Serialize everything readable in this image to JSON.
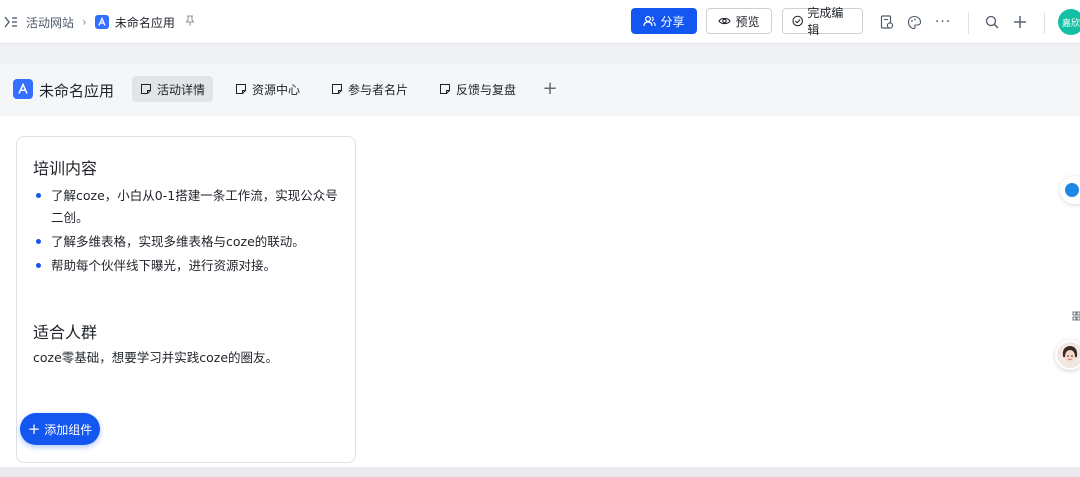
{
  "breadcrumb": {
    "site": "活动网站",
    "separator": "›",
    "current": "未命名应用"
  },
  "toolbar": {
    "share_label": "分享",
    "preview_label": "预览",
    "finish_label": "完成编辑",
    "more_label": "···",
    "avatar_text": "嘉欣"
  },
  "app": {
    "name": "未命名应用",
    "tabs": [
      {
        "label": "活动详情",
        "active": true
      },
      {
        "label": "资源中心",
        "active": false
      },
      {
        "label": "参与者名片",
        "active": false
      },
      {
        "label": "反馈与复盘",
        "active": false
      }
    ],
    "add_tab": "+"
  },
  "card": {
    "training_title": "培训内容",
    "training_items": [
      "了解coze，小白从0-1搭建一条工作流，实现公众号二创。",
      "了解多维表格，实现多维表格与coze的联动。",
      "帮助每个伙伴线下曝光，进行资源对接。"
    ],
    "audience_title": "适合人群",
    "audience_text": "coze零基础，想要学习并实践coze的圈友。"
  },
  "add_component": {
    "icon": "+",
    "label": "添加组件"
  },
  "colors": {
    "primary": "#1456f0",
    "app_blue": "#3370ff",
    "avatar_green": "#14c0a4"
  }
}
